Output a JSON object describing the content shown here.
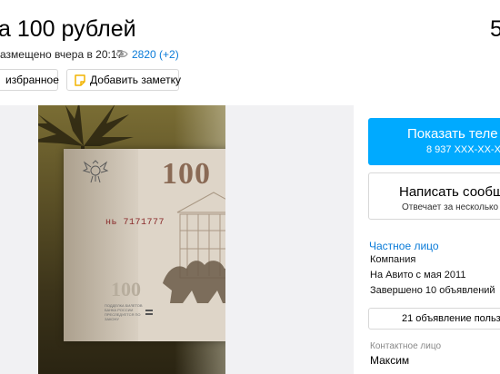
{
  "listing": {
    "title": "а 100 рублей",
    "price": "5",
    "meta": {
      "posted": "азмещено вчера в 20:17",
      "views": "2820 (+2)",
      "views_icon": "eye-icon"
    },
    "actions": {
      "favorite_label": "избранное",
      "note_label": "Добавить заметку",
      "note_icon": "note-icon"
    },
    "photo": {
      "banknote_denomination": "100",
      "banknote_serial": "нь 7171777",
      "banknote_small_denomination": "100",
      "banknote_fine_print": "ПОДДЕЛКА БИЛЕТОВ БАНКА РОССИИ ПРЕСЛЕДУЕТСЯ ПО ЗАКОНУ"
    }
  },
  "contact": {
    "phone_button_label": "Показать теле",
    "phone_number_masked": "8 937 XXX-XX-X",
    "message_button_label": "Написать сообщ",
    "message_button_sub": "Отвечает за несколько"
  },
  "seller": {
    "type_link": "Частное лицо",
    "lines": [
      "Компания",
      "На Авито с мая 2011",
      "Завершено 10 объявлений"
    ],
    "ads_button_label": "21 объявление польз",
    "contact_person_label": "Контактное лицо",
    "contact_person_name": "Максим"
  },
  "colors": {
    "accent": "#00aaff",
    "link": "#0a7bd8"
  }
}
